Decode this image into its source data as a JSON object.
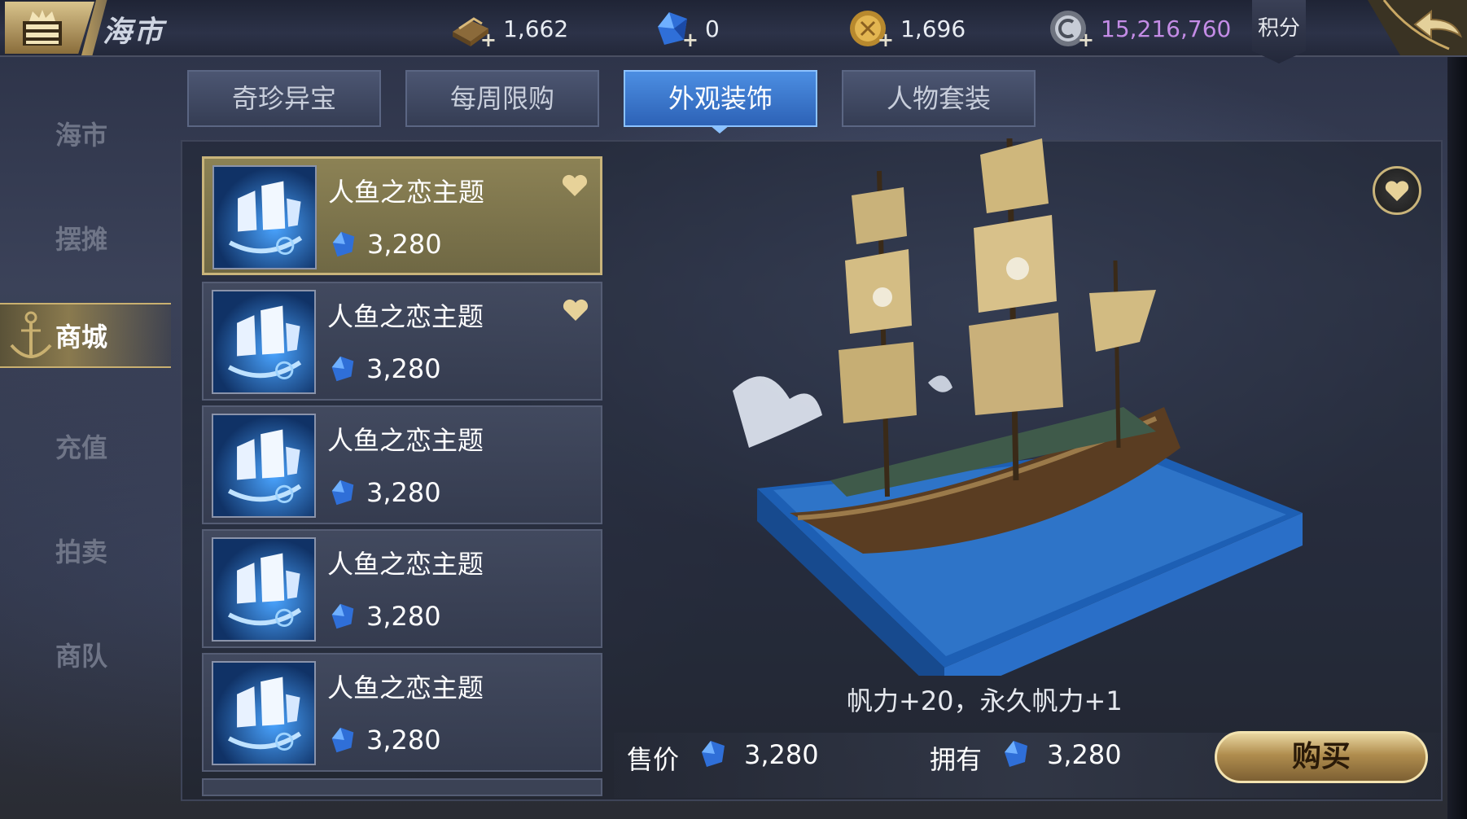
{
  "header": {
    "title": "海市",
    "currencies": [
      {
        "icon": "gold-bar-icon",
        "value": "1,662"
      },
      {
        "icon": "blue-gem-icon",
        "value": "0"
      },
      {
        "icon": "gold-coin-icon",
        "value": "1,696"
      },
      {
        "icon": "silver-coin-icon",
        "value": "15,216,760"
      }
    ],
    "score_label": "积分"
  },
  "sidebar": {
    "items": [
      {
        "label": "海市",
        "active": false
      },
      {
        "label": "摆摊",
        "active": false
      },
      {
        "label": "商城",
        "active": true
      },
      {
        "label": "充值",
        "active": false
      },
      {
        "label": "拍卖",
        "active": false
      },
      {
        "label": "商队",
        "active": false
      }
    ]
  },
  "tabs": [
    {
      "label": "奇珍异宝",
      "active": false
    },
    {
      "label": "每周限购",
      "active": false
    },
    {
      "label": "外观装饰",
      "active": true
    },
    {
      "label": "人物套装",
      "active": false
    }
  ],
  "items": [
    {
      "name": "人鱼之恋主题",
      "price": "3,280",
      "favorited": true,
      "selected": true
    },
    {
      "name": "人鱼之恋主题",
      "price": "3,280",
      "favorited": true,
      "selected": false
    },
    {
      "name": "人鱼之恋主题",
      "price": "3,280",
      "favorited": false,
      "selected": false
    },
    {
      "name": "人鱼之恋主题",
      "price": "3,280",
      "favorited": false,
      "selected": false
    },
    {
      "name": "人鱼之恋主题",
      "price": "3,280",
      "favorited": false,
      "selected": false
    }
  ],
  "detail": {
    "attributes": "帆力+20，永久帆力+1",
    "price_label": "售价",
    "price_value": "3,280",
    "own_label": "拥有",
    "own_value": "3,280",
    "buy_label": "购买"
  },
  "colors": {
    "active_tab": "#2d62b6",
    "gold_accent": "#c9b47a",
    "gem_blue": "#3a7be0",
    "points_purple": "#c48ce6"
  }
}
